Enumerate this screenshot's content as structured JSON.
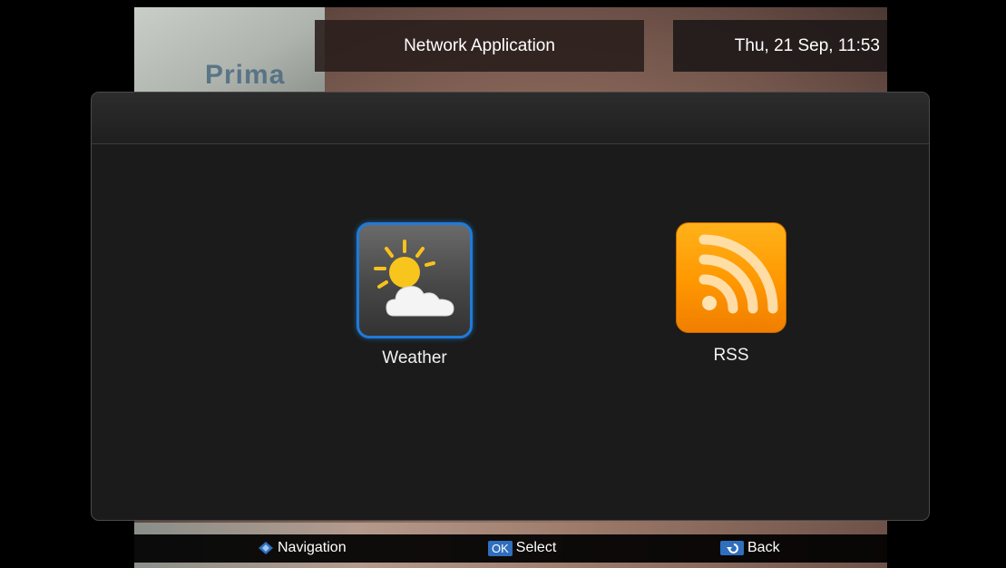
{
  "header": {
    "title": "Network Application",
    "datetime": "Thu, 21 Sep, 11:53"
  },
  "background": {
    "channel_logo": "Prima"
  },
  "apps": [
    {
      "label": "Weather",
      "icon": "weather-sun-cloud-icon",
      "selected": true
    },
    {
      "label": "RSS",
      "icon": "rss-feed-icon",
      "selected": false
    }
  ],
  "footer": {
    "navigation_label": "Navigation",
    "ok_key": "OK",
    "select_label": "Select",
    "back_label": "Back"
  },
  "colors": {
    "selection_border": "#1f7bd8",
    "rss_orange": "#ff9700",
    "panel_bg": "#1b1b1b",
    "key_blue": "#2f6fbd"
  }
}
